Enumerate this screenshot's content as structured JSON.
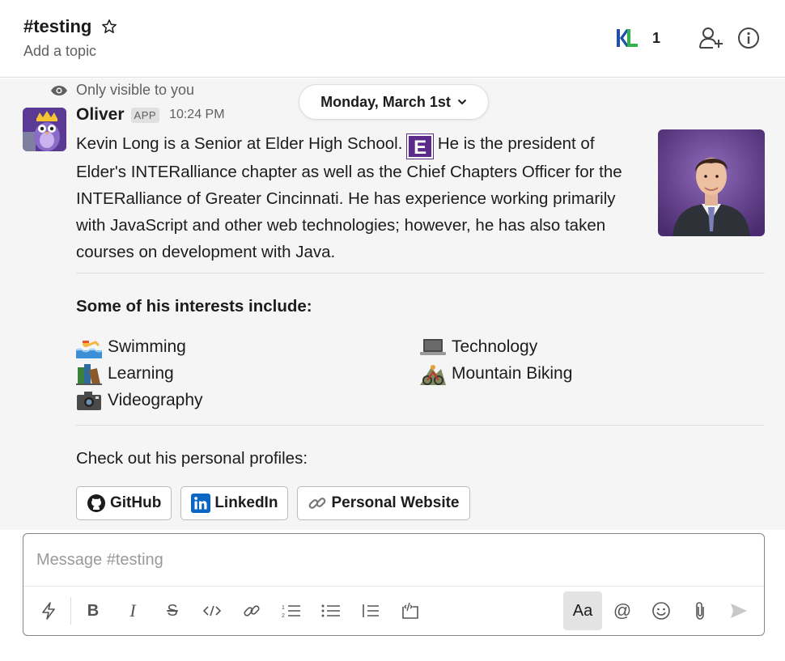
{
  "header": {
    "channel": "#testing",
    "topic": "Add a topic",
    "member_initials": "KL",
    "member_count": "1",
    "icons": [
      "star-icon",
      "add-member-icon",
      "info-icon"
    ]
  },
  "message": {
    "visibility": "Only visible to you",
    "date": "Monday, March 1st",
    "sender": "Oliver",
    "badge": "APP",
    "time": "10:24 PM",
    "bio_part1": "Kevin Long is a Senior at Elder High School.",
    "bio_logo": "E",
    "bio_part2": "He is the president of Elder's INTERalliance chapter as well as the Chief Chapters Officer for the INTERalliance of Greater Cincinnati. He has experience working primarily with JavaScript and other web technologies; however, he has also taken courses on development with Java.",
    "interests_title": "Some of his interests include:",
    "interests": [
      {
        "emoji": "swimmer-emoji",
        "label": "Swimming"
      },
      {
        "emoji": "laptop-emoji",
        "label": "Technology"
      },
      {
        "emoji": "books-emoji",
        "label": "Learning"
      },
      {
        "emoji": "mountain-biker-emoji",
        "label": "Mountain Biking"
      },
      {
        "emoji": "camera-emoji",
        "label": "Videography"
      }
    ],
    "profiles_title": "Check out his personal profiles:",
    "buttons": [
      {
        "icon": "github-icon",
        "label": "GitHub"
      },
      {
        "icon": "linkedin-icon",
        "label": "LinkedIn"
      },
      {
        "icon": "link-icon",
        "label": "Personal Website"
      }
    ]
  },
  "composer": {
    "placeholder": "Message #testing",
    "aa_label": "Aa",
    "tools": [
      "shortcuts-icon",
      "bold-icon",
      "italic-icon",
      "strikethrough-icon",
      "code-icon",
      "link-icon",
      "ordered-list-icon",
      "bulleted-list-icon",
      "blockquote-icon",
      "code-block-icon",
      "mention-icon",
      "emoji-icon",
      "attach-icon",
      "send-icon"
    ]
  },
  "colors": {
    "app_purple": "#5b2b8c",
    "avatar_purple": "#6a3fa0",
    "message_bg": "#f5f5f5",
    "linkedin_blue": "#0a66c2"
  }
}
